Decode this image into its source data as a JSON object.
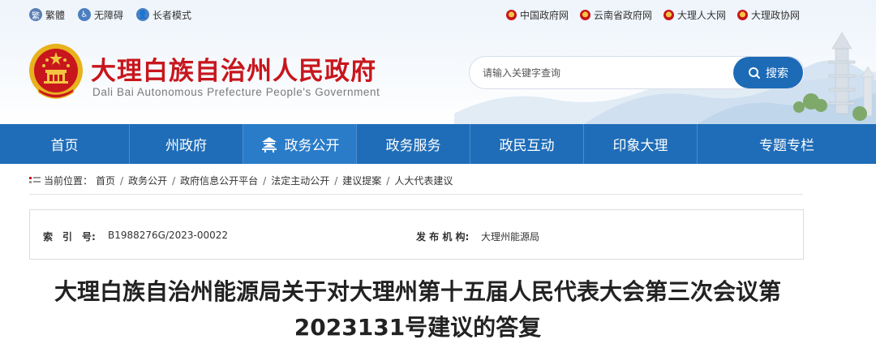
{
  "utility": {
    "traditional": "繁體",
    "accessibility": "无障碍",
    "elder_mode": "长者模式"
  },
  "links": [
    "中国政府网",
    "云南省政府网",
    "大理人大网",
    "大理政协网"
  ],
  "site": {
    "title": "大理白族自治州人民政府",
    "subtitle": "Dali Bai Autonomous Prefecture People's Government"
  },
  "search": {
    "placeholder": "请输入关键字查询",
    "button_label": "搜索"
  },
  "nav": [
    "首页",
    "州政府",
    "政务公开",
    "政务服务",
    "政民互动",
    "印象大理",
    "专题专栏"
  ],
  "breadcrumb": {
    "label": "当前位置：",
    "items": [
      "首页",
      "政务公开",
      "政府信息公开平台",
      "法定主动公开",
      "建议提案",
      "人大代表建议"
    ]
  },
  "meta": {
    "index_label": "索　引　号:",
    "index_value": "B1988276G/2023-00022",
    "publisher_label": "发 布 机 构:",
    "publisher_value": "大理州能源局"
  },
  "article": {
    "title_line1": "大理白族自治州能源局关于对大理州第十五届人民代表大会第三次会议第",
    "title_line2": "2023131号建议的答复"
  },
  "colors": {
    "nav_blue": "#1f6db8",
    "title_red": "#c8161d",
    "search_blue": "#1d6bb7"
  }
}
